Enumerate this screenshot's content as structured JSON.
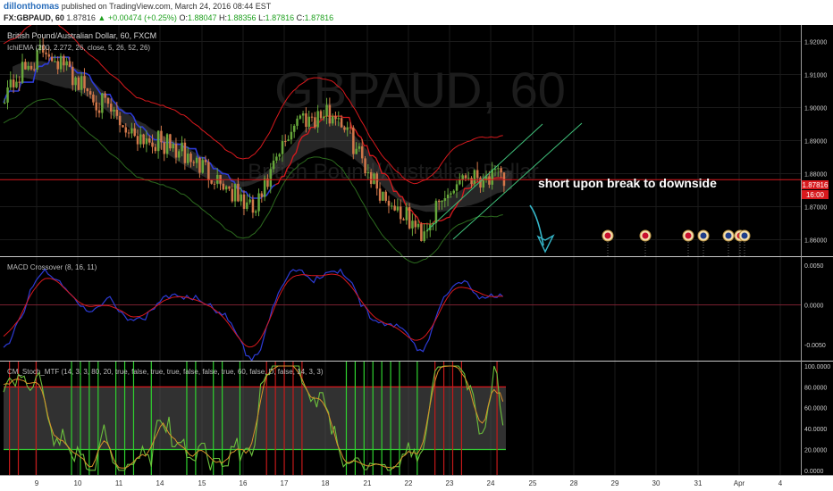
{
  "header": {
    "author": "dillonthomas",
    "published": "published on TradingView.com, March 24, 2016 08:44 EST",
    "symbol": "FX:GBPAUD, 60",
    "last": "1.87816",
    "change": "+0.00474 (+0.25%)",
    "o_label": "O:",
    "o_val": "1.88047",
    "h_label": "H:",
    "h_val": "1.88356",
    "l_label": "L:",
    "l_val": "1.87816",
    "c_label": "C:",
    "c_val": "1.87816"
  },
  "main": {
    "title": "British Pound/Australian Dollar, 60, FXCM",
    "indicator": "IchiEMA (200, 2.272, 26, close, 5, 26, 52, 26)",
    "watermark": "GBPAUD, 60",
    "watermark_sub": "British Pound/Australian Dollar",
    "annotation": "short  upon break to downside",
    "price_tag": "1.87816",
    "time_tag": "16:00"
  },
  "macd": {
    "title": "MACD Crossover (8, 16, 11)"
  },
  "stoch": {
    "title": "CM_Stoch_MTF (14, 3, 3, 80, 20, true, false, true, true, false, false, true, 60, false, D, false, 14, 3, 3)"
  },
  "x_ticks": [
    "9",
    "10",
    "11",
    "14",
    "15",
    "16",
    "17",
    "18",
    "21",
    "22",
    "23",
    "24",
    "25",
    "28",
    "29",
    "30",
    "31",
    "Apr",
    "4"
  ],
  "colors": {
    "background": "#000000",
    "up": "#66a63a",
    "down": "#d1774a",
    "upper_band": "#d8191d",
    "mid_band": "#2d3bd6",
    "lower_band": "#2c6a1e",
    "cloud": "#555555",
    "channel": "#3fbf7a",
    "arrow": "#35b6c9",
    "tag": "#d8191d"
  },
  "chart_data": [
    {
      "type": "candlestick",
      "name": "price",
      "x": [
        "9",
        "10",
        "11",
        "14",
        "15",
        "16",
        "17",
        "18",
        "21",
        "22",
        "23",
        "24",
        "24"
      ],
      "close": [
        1.905,
        1.918,
        1.905,
        1.893,
        1.888,
        1.88,
        1.868,
        1.897,
        1.898,
        1.875,
        1.862,
        1.88,
        1.87816
      ],
      "ylim": [
        1.855,
        1.925
      ],
      "y_ticks": [
        "1.92000",
        "1.91000",
        "1.90000",
        "1.89000",
        "1.88000",
        "1.87000",
        "1.86000"
      ]
    },
    {
      "type": "line",
      "name": "macd",
      "ylim": [
        -0.007,
        0.006
      ],
      "y_ticks": [
        "0.0050",
        "0.0000",
        "-0.0050"
      ]
    },
    {
      "type": "line",
      "name": "stoch",
      "ylim": [
        0,
        100
      ],
      "y_ticks": [
        "100.0000",
        "80.0000",
        "60.0000",
        "40.0000",
        "20.0000",
        "0.0000"
      ]
    }
  ]
}
